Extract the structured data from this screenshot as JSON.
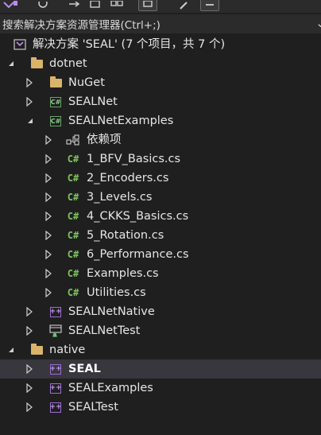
{
  "toolbar": {
    "icons": [
      "solution-icon",
      "back-icon",
      "redo-icon",
      "refresh-icon",
      "stack-icon",
      "sync-icon",
      "wrench-icon",
      "collapse-icon"
    ]
  },
  "search": {
    "placeholder": "搜索解决方案资源管理器(Ctrl+;)"
  },
  "tree": {
    "solution": "解决方案 'SEAL' (7 个项目，共 7 个)",
    "dotnet": "dotnet",
    "nuget": "NuGet",
    "sealnet": "SEALNet",
    "sealnetexamples": "SEALNetExamples",
    "deps": "依赖项",
    "files": {
      "f1": "1_BFV_Basics.cs",
      "f2": "2_Encoders.cs",
      "f3": "3_Levels.cs",
      "f4": "4_CKKS_Basics.cs",
      "f5": "5_Rotation.cs",
      "f6": "6_Performance.cs",
      "f7": "Examples.cs",
      "f8": "Utilities.cs"
    },
    "sealnetnative": "SEALNetNative",
    "sealnettest": "SEALNetTest",
    "native": "native",
    "seal": "SEAL",
    "sealexamples": "SEALExamples",
    "sealtest": "SEALTest"
  },
  "colors": {
    "background": "#1f1f1f",
    "selected_row": "#37373d",
    "csharp_green": "#7ec45f",
    "folder": "#d9b46a",
    "cpp_purple": "#a06bd4"
  }
}
